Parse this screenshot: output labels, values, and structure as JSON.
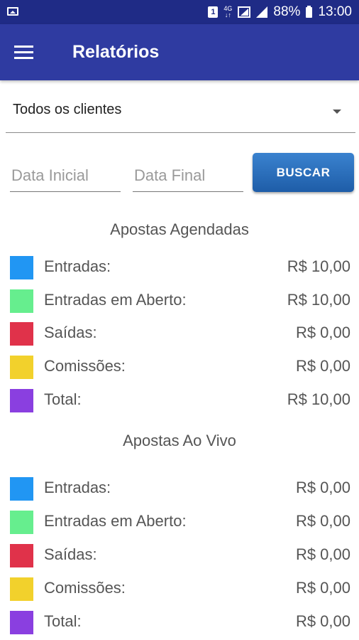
{
  "status_bar": {
    "sim_label": "1",
    "network_top": "4G",
    "network_bottom": "↓↑",
    "battery": "88%",
    "time": "13:00"
  },
  "app_bar": {
    "title": "Relatórios"
  },
  "filters": {
    "client_value": "Todos os clientes",
    "date_start_placeholder": "Data Inicial",
    "date_end_placeholder": "Data Final",
    "search_label": "BUSCAR"
  },
  "colors": {
    "entradas": "#2196F3",
    "entradas_aberto": "#66EE8E",
    "saidas": "#E0324A",
    "comissoes": "#F2D12C",
    "total": "#8A3FE0",
    "primary": "#2F3BA1",
    "status_bar": "#1F2B86"
  },
  "sections": [
    {
      "title": "Apostas Agendadas",
      "rows": [
        {
          "label": "Entradas:",
          "value": "R$ 10,00"
        },
        {
          "label": "Entradas em Aberto:",
          "value": "R$ 10,00"
        },
        {
          "label": "Saídas:",
          "value": "R$ 0,00"
        },
        {
          "label": "Comissões:",
          "value": "R$ 0,00"
        },
        {
          "label": "Total:",
          "value": "R$ 10,00"
        }
      ]
    },
    {
      "title": "Apostas Ao Vivo",
      "rows": [
        {
          "label": "Entradas:",
          "value": "R$ 0,00"
        },
        {
          "label": "Entradas em Aberto:",
          "value": "R$ 0,00"
        },
        {
          "label": "Saídas:",
          "value": "R$ 0,00"
        },
        {
          "label": "Comissões:",
          "value": "R$ 0,00"
        },
        {
          "label": "Total:",
          "value": "R$ 0,00"
        }
      ]
    }
  ]
}
